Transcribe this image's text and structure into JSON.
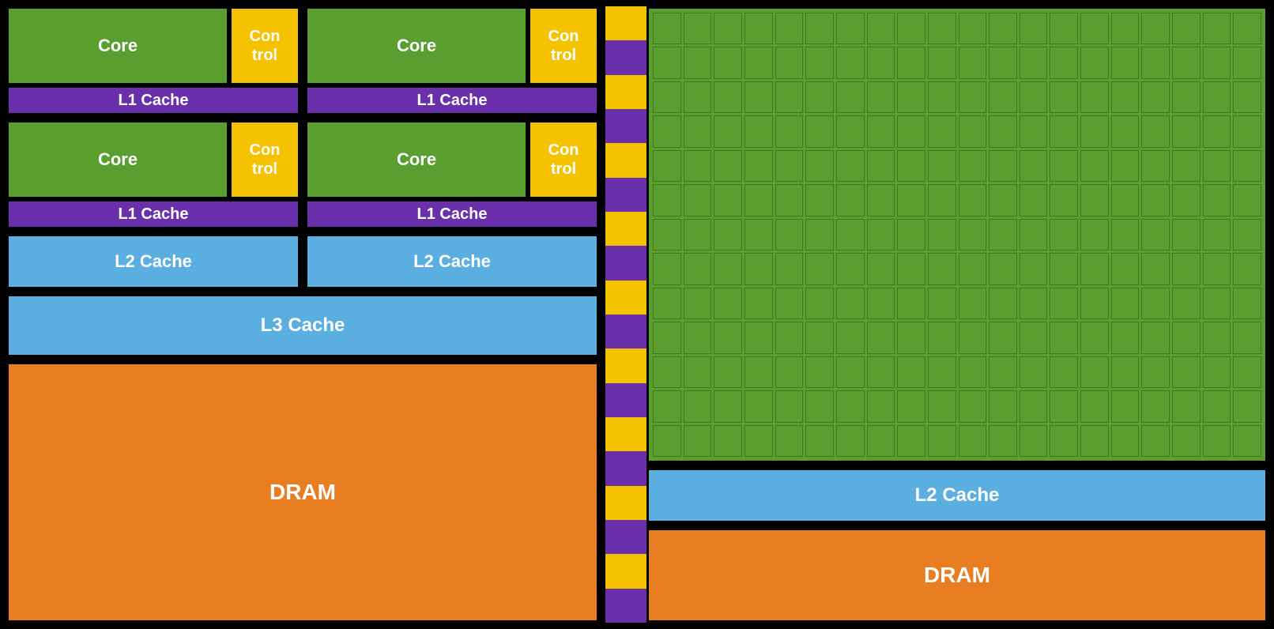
{
  "left": {
    "row1": {
      "pair1": {
        "core_label": "Core",
        "control_label": "Con\ntrol",
        "l1_label": "L1 Cache"
      },
      "pair2": {
        "core_label": "Core",
        "control_label": "Con\ntrol",
        "l1_label": "L1 Cache"
      }
    },
    "row2": {
      "pair1": {
        "core_label": "Core",
        "control_label": "Con\ntrol",
        "l1_label": "L1 Cache"
      },
      "pair2": {
        "core_label": "Core",
        "control_label": "Con\ntrol",
        "l1_label": "L1 Cache"
      }
    },
    "l2_left": "L2 Cache",
    "l2_right": "L2 Cache",
    "l3": "L3 Cache",
    "dram": "DRAM"
  },
  "right": {
    "l2": "L2 Cache",
    "dram": "DRAM",
    "grid_cols": 20,
    "grid_rows": 13
  },
  "colors": {
    "green": "#5a9e2f",
    "gold": "#f5c200",
    "purple": "#6a2faa",
    "blue": "#5baee0",
    "orange": "#e87d22",
    "black": "#000000"
  }
}
